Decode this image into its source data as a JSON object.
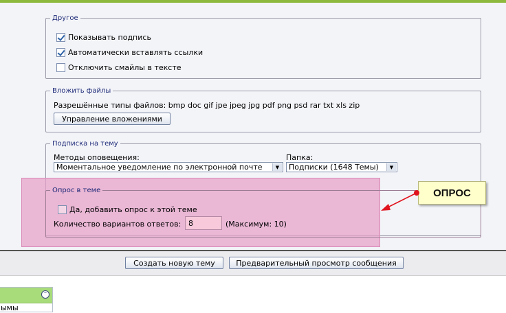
{
  "other": {
    "legend": "Другое",
    "options": [
      {
        "label": "Показывать подпись",
        "checked": true
      },
      {
        "label": "Автоматически вставлять ссылки",
        "checked": true
      },
      {
        "label": "Отключить смайлы в тексте",
        "checked": false
      }
    ]
  },
  "attach": {
    "legend": "Вложить файлы",
    "allowed_types": "Разрешённые типы файлов: bmp doc gif jpe jpeg jpg pdf png psd rar txt xls zip",
    "manage_button": "Управление вложениями"
  },
  "subscribe": {
    "legend": "Подписка на тему",
    "methods_label": "Методы оповещения:",
    "methods_value": "Моментальное уведомление по электронной почте",
    "folder_label": "Папка:",
    "folder_value": "Подписки (1648 Темы)"
  },
  "poll": {
    "legend": "Опрос в теме",
    "add_poll_label": "Да, добавить опрос к этой теме",
    "add_poll_checked": false,
    "count_label": "Количество вариантов ответов:",
    "count_value": "8",
    "max_label": "(Максимум: 10)"
  },
  "callout": {
    "text": "ОПРОС",
    "accent": "#e0141e"
  },
  "actions": {
    "create_button": "Создать новую тему",
    "preview_button": "Предварительный просмотр сообщения"
  },
  "side": {
    "text": "ымы"
  }
}
